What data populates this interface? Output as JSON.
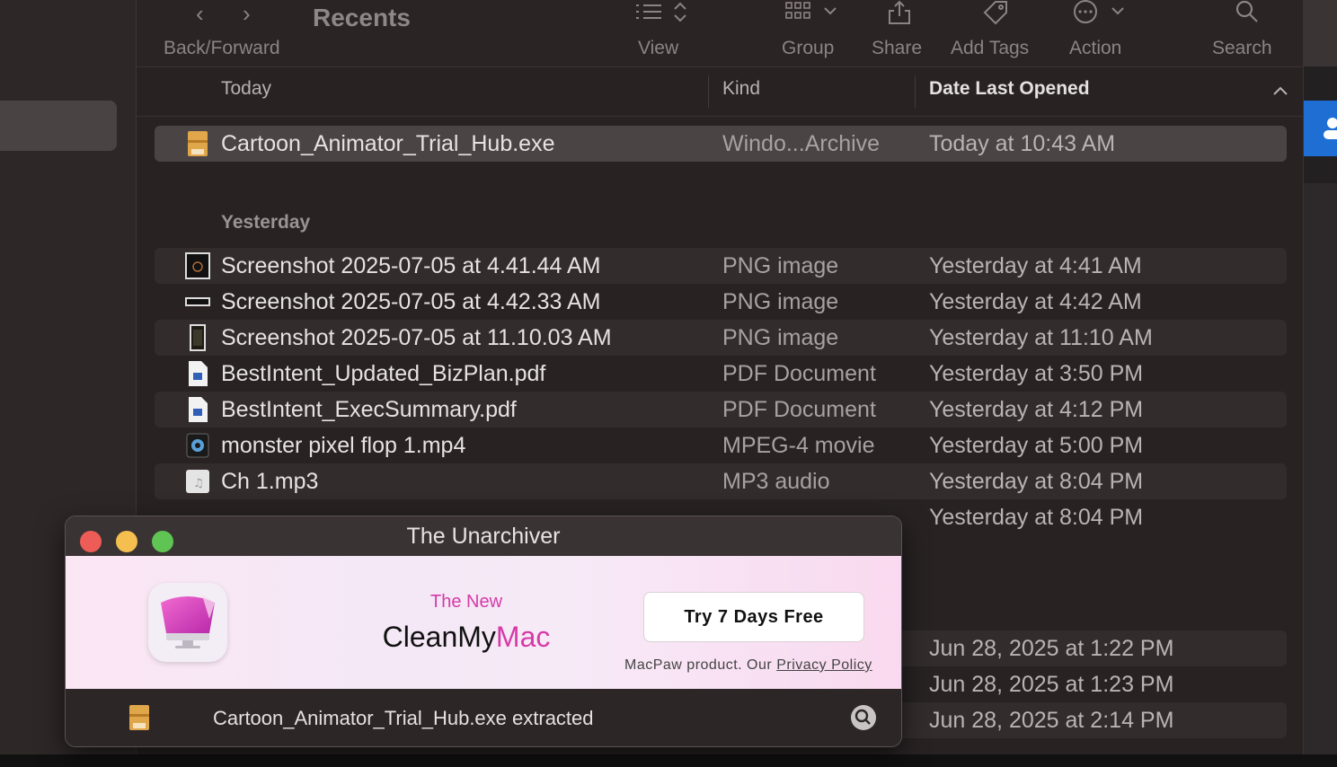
{
  "toolbar": {
    "title": "Recents",
    "back_forward_label": "Back/Forward",
    "view_label": "View",
    "group_label": "Group",
    "share_label": "Share",
    "add_tags_label": "Add Tags",
    "action_label": "Action",
    "search_label": "Search"
  },
  "columns": {
    "name": "Today",
    "kind": "Kind",
    "date": "Date Last Opened"
  },
  "sections": {
    "yesterday": "Yesterday"
  },
  "files": [
    {
      "name": "Cartoon_Animator_Trial_Hub.exe",
      "kind": "Windo...Archive",
      "date": "Today at 10:43 AM",
      "icon": "archive-icon"
    },
    {
      "name": "Screenshot 2025-07-05 at 4.41.44 AM",
      "kind": "PNG image",
      "date": "Yesterday at 4:41 AM",
      "icon": "image-icon"
    },
    {
      "name": "Screenshot 2025-07-05 at 4.42.33 AM",
      "kind": "PNG image",
      "date": "Yesterday at 4:42 AM",
      "icon": "image-icon"
    },
    {
      "name": "Screenshot 2025-07-05 at 11.10.03 AM",
      "kind": "PNG image",
      "date": "Yesterday at 11:10 AM",
      "icon": "image-icon"
    },
    {
      "name": "BestIntent_Updated_BizPlan.pdf",
      "kind": "PDF Document",
      "date": "Yesterday at 3:50 PM",
      "icon": "pdf-icon"
    },
    {
      "name": "BestIntent_ExecSummary.pdf",
      "kind": "PDF Document",
      "date": "Yesterday at 4:12 PM",
      "icon": "pdf-icon"
    },
    {
      "name": "monster pixel flop 1.mp4",
      "kind": "MPEG-4 movie",
      "date": "Yesterday at 5:00 PM",
      "icon": "video-icon"
    },
    {
      "name": "Ch 1.mp3",
      "kind": "MP3 audio",
      "date": "Yesterday at 8:04 PM",
      "icon": "audio-icon"
    },
    {
      "name": "",
      "kind": "",
      "date": "Yesterday at 8:04 PM",
      "icon": "audio-icon"
    }
  ],
  "older_dates": [
    "Jun 28, 2025 at 1:22 PM",
    "Jun 28, 2025 at 1:23 PM",
    "Jun 28, 2025 at 2:14 PM"
  ],
  "unarchiver": {
    "title": "The Unarchiver",
    "ad_tagline": "The New",
    "ad_brand_a": "CleanMy",
    "ad_brand_b": "Mac",
    "ad_button": "Try 7 Days Free",
    "ad_footer": "MacPaw product. Our",
    "ad_privacy": "Privacy Policy",
    "status": "Cartoon_Animator_Trial_Hub.exe extracted"
  },
  "colors": {
    "accent_pink": "#d63aa8",
    "close": "#ed5c57",
    "minimize": "#f4bf4f",
    "zoom": "#5fc453",
    "blue": "#1f6ed4"
  }
}
